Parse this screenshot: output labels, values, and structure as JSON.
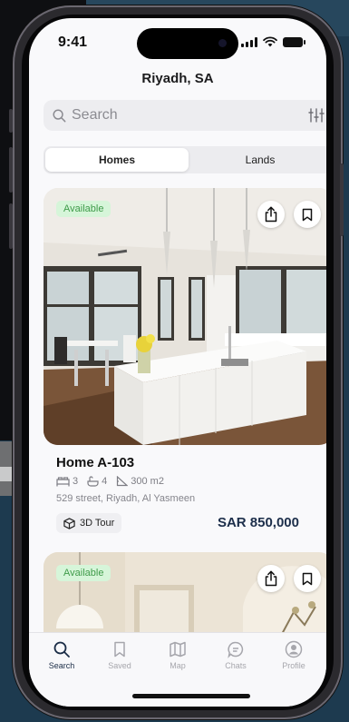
{
  "status_bar": {
    "time": "9:41"
  },
  "header": {
    "location": "Riyadh, SA"
  },
  "search": {
    "placeholder": "Search"
  },
  "segment": {
    "tabs": [
      "Homes",
      "Lands"
    ],
    "active": "Homes"
  },
  "listings": [
    {
      "badge": "Available",
      "title": "Home A-103",
      "beds": "3",
      "baths": "4",
      "area": "300 m2",
      "address": "529 street, Riyadh, Al Yasmeen",
      "tour_label": "3D Tour",
      "price": "SAR 850,000"
    },
    {
      "badge": "Available"
    }
  ],
  "tab_bar": {
    "items": [
      "Search",
      "Saved",
      "Map",
      "Chats",
      "Profile"
    ],
    "active": "Search"
  },
  "colors": {
    "accent": "#1b2d47",
    "badge_bg": "#d6f5d9",
    "badge_text": "#3f9b4a",
    "price": "#1c2e4a"
  }
}
